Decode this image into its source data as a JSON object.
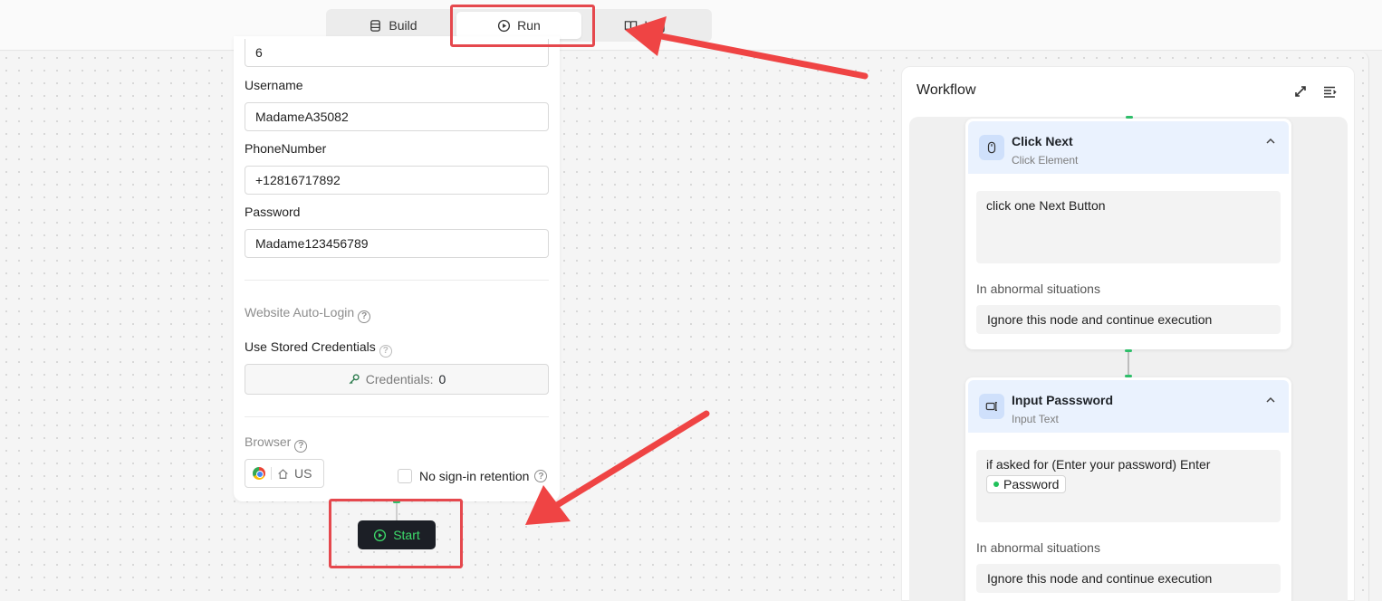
{
  "topbar": {
    "tabs": [
      {
        "label": "Build",
        "icon": "build-icon",
        "active": false
      },
      {
        "label": "Run",
        "icon": "play-circle-icon",
        "active": true
      },
      {
        "label": "Log",
        "icon": "book-icon",
        "active": false
      }
    ]
  },
  "form": {
    "top_value": "6",
    "username": {
      "label": "Username",
      "value": "MadameA35082"
    },
    "phone": {
      "label": "PhoneNumber",
      "value": "+12816717892"
    },
    "password": {
      "label": "Password",
      "value": "Madame123456789"
    },
    "auto_login_label": "Website Auto-Login",
    "stored_credentials_label": "Use Stored Credentials",
    "credentials": {
      "label": "Credentials:",
      "count": "0"
    },
    "browser_label": "Browser",
    "browser_region": "US",
    "no_signin_label": "No sign-in retention",
    "help_glyph": "?"
  },
  "start_button": {
    "label": "Start"
  },
  "workflow": {
    "title": "Workflow",
    "nodes": [
      {
        "title": "Click Next",
        "subtitle": "Click Element",
        "icon": "mouse-icon",
        "body": "click one Next Button",
        "abnormal_label": "In abnormal situations",
        "abnormal_option": "Ignore this node and continue execution"
      },
      {
        "title": "Input Passsword",
        "subtitle": "Input Text",
        "icon": "keyboard-input-icon",
        "body": "if asked for (Enter your password) Enter",
        "variable": "Password",
        "abnormal_label": "In abnormal situations",
        "abnormal_option": "Ignore this node and continue execution"
      }
    ]
  },
  "colors": {
    "accent_green": "#3ddc6b",
    "highlight_red": "#e5484d",
    "node_header": "#eaf2fe"
  }
}
